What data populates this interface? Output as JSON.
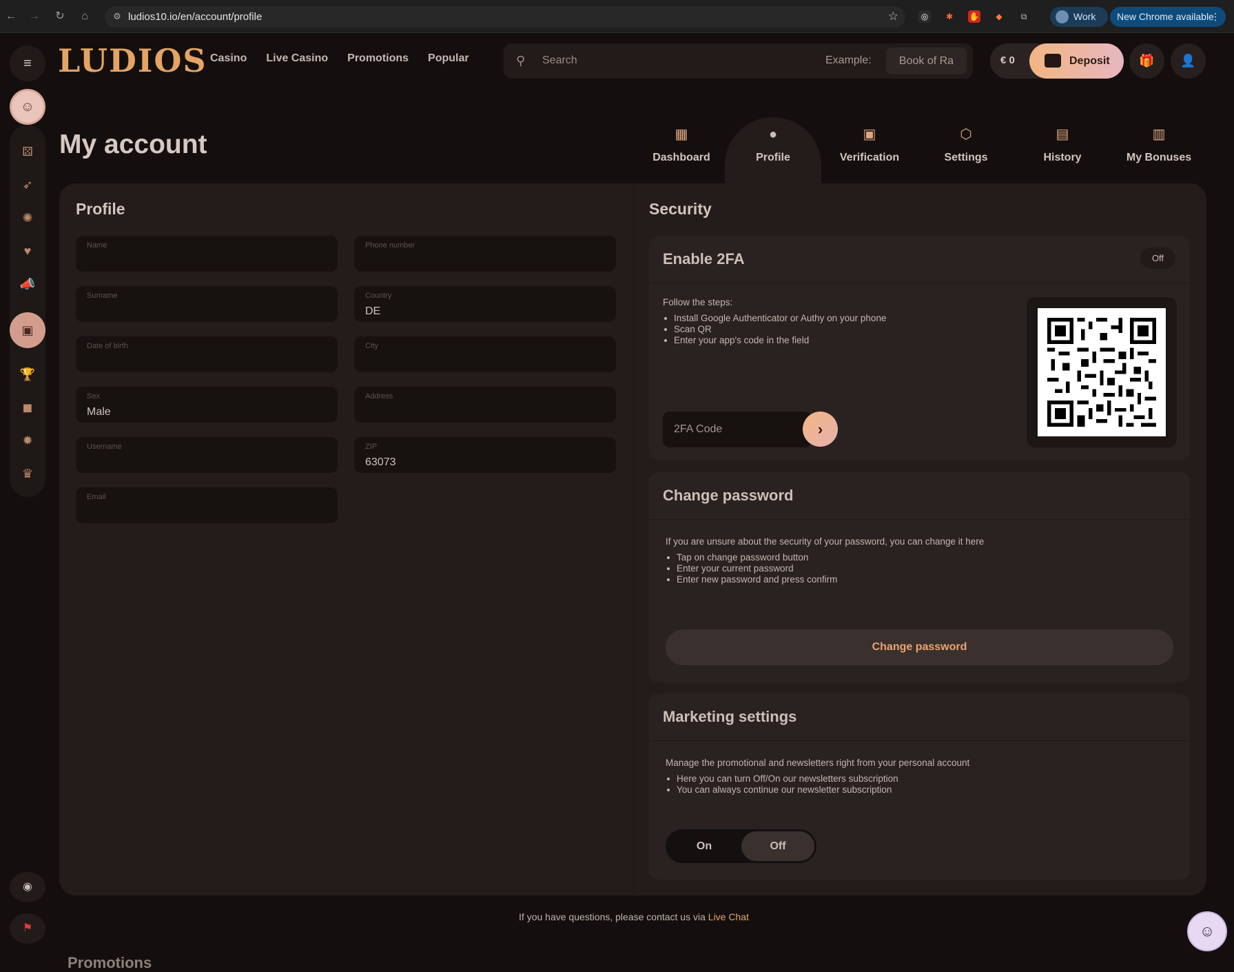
{
  "browser": {
    "url": "ludios10.io/en/account/profile",
    "profile_label": "Work",
    "update_label": "New Chrome available"
  },
  "header": {
    "logo": "LUDIOS",
    "nav": [
      "Casino",
      "Live Casino",
      "Promotions",
      "Popular"
    ],
    "search_placeholder": "Search",
    "example_label": "Example:",
    "example_chip": "Book of Ra",
    "balance": "€ 0",
    "deposit_label": "Deposit"
  },
  "page": {
    "title": "My account",
    "tabs": [
      {
        "label": "Dashboard",
        "icon": "dashboard-icon"
      },
      {
        "label": "Profile",
        "icon": "user-icon"
      },
      {
        "label": "Verification",
        "icon": "id-card-icon"
      },
      {
        "label": "Settings",
        "icon": "gear-icon"
      },
      {
        "label": "History",
        "icon": "book-icon"
      },
      {
        "label": "My Bonuses",
        "icon": "gift-icon"
      }
    ],
    "active_tab": "Profile"
  },
  "profile": {
    "title": "Profile",
    "fields": {
      "name": {
        "label": "Name",
        "value": ""
      },
      "phone": {
        "label": "Phone number",
        "value": ""
      },
      "surname": {
        "label": "Surname",
        "value": ""
      },
      "country": {
        "label": "Country",
        "value": "DE"
      },
      "dob": {
        "label": "Date of birth",
        "value": ""
      },
      "city": {
        "label": "City",
        "value": ""
      },
      "sex": {
        "label": "Sex",
        "value": "Male"
      },
      "address": {
        "label": "Address",
        "value": ""
      },
      "username": {
        "label": "Username",
        "value": ""
      },
      "zip": {
        "label": "ZIP",
        "value": "63073"
      },
      "email": {
        "label": "Email",
        "value": ""
      }
    }
  },
  "security": {
    "title": "Security",
    "twofa": {
      "title": "Enable 2FA",
      "status": "Off",
      "intro": "Follow the steps:",
      "steps": [
        "Install Google Authenticator or Authy on your phone",
        "Scan QR",
        "Enter your app's code in the field"
      ],
      "code_placeholder": "2FA Code"
    },
    "password": {
      "title": "Change password",
      "intro": "If you are unsure about the security of your password, you can change it here",
      "steps": [
        "Tap on change password button",
        "Enter your current password",
        "Enter new password and press confirm"
      ],
      "button": "Change password"
    },
    "marketing": {
      "title": "Marketing settings",
      "intro": "Manage the promotional and newsletters right from your personal account",
      "steps": [
        "Here you can turn Off/On our newsletters subscription",
        "You can always continue our newsletter subscription"
      ],
      "on_label": "On",
      "off_label": "Off",
      "selected": "Off"
    }
  },
  "footer": {
    "note": "If you have questions, please contact us via",
    "link": "Live Chat",
    "next_section": "Promotions"
  },
  "colors": {
    "accent": "#e3a464",
    "background": "#140f0e",
    "panel": "#231c1a"
  }
}
